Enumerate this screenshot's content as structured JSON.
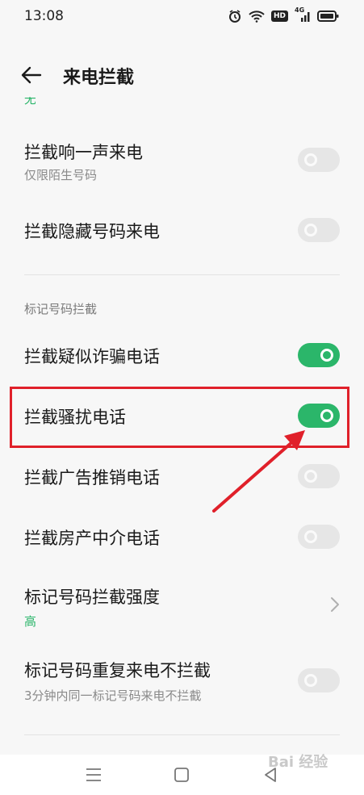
{
  "status_bar": {
    "time": "13:08",
    "hd_label": "HD",
    "network_label": "4G"
  },
  "header": {
    "title": "来电拦截",
    "back_icon": "arrow-left-icon"
  },
  "peek_text": "无",
  "rows": {
    "ring_once": {
      "label": "拦截响一声来电",
      "sub": "仅限陌生号码",
      "toggle": "off"
    },
    "hidden_number": {
      "label": "拦截隐藏号码来电",
      "toggle": "off"
    },
    "section_title": "标记号码拦截",
    "fraud": {
      "label": "拦截疑似诈骗电话",
      "toggle": "on"
    },
    "harass": {
      "label": "拦截骚扰电话",
      "toggle": "on"
    },
    "ads": {
      "label": "拦截广告推销电话",
      "toggle": "off"
    },
    "real_estate": {
      "label": "拦截房产中介电话",
      "toggle": "off"
    },
    "strength": {
      "label": "标记号码拦截强度",
      "value": "高"
    },
    "repeat": {
      "label": "标记号码重复来电不拦截",
      "sub": "3分钟内同一标记号码来电不拦截",
      "toggle": "off"
    }
  },
  "nav": {
    "menu_icon": "menu-icon",
    "home_icon": "home-square-icon",
    "back_icon": "back-triangle-icon"
  },
  "watermark": "Bai 经验",
  "colors": {
    "accent_green": "#2bb66a",
    "highlight_red": "#e0202a",
    "background": "#f7f7f7"
  }
}
